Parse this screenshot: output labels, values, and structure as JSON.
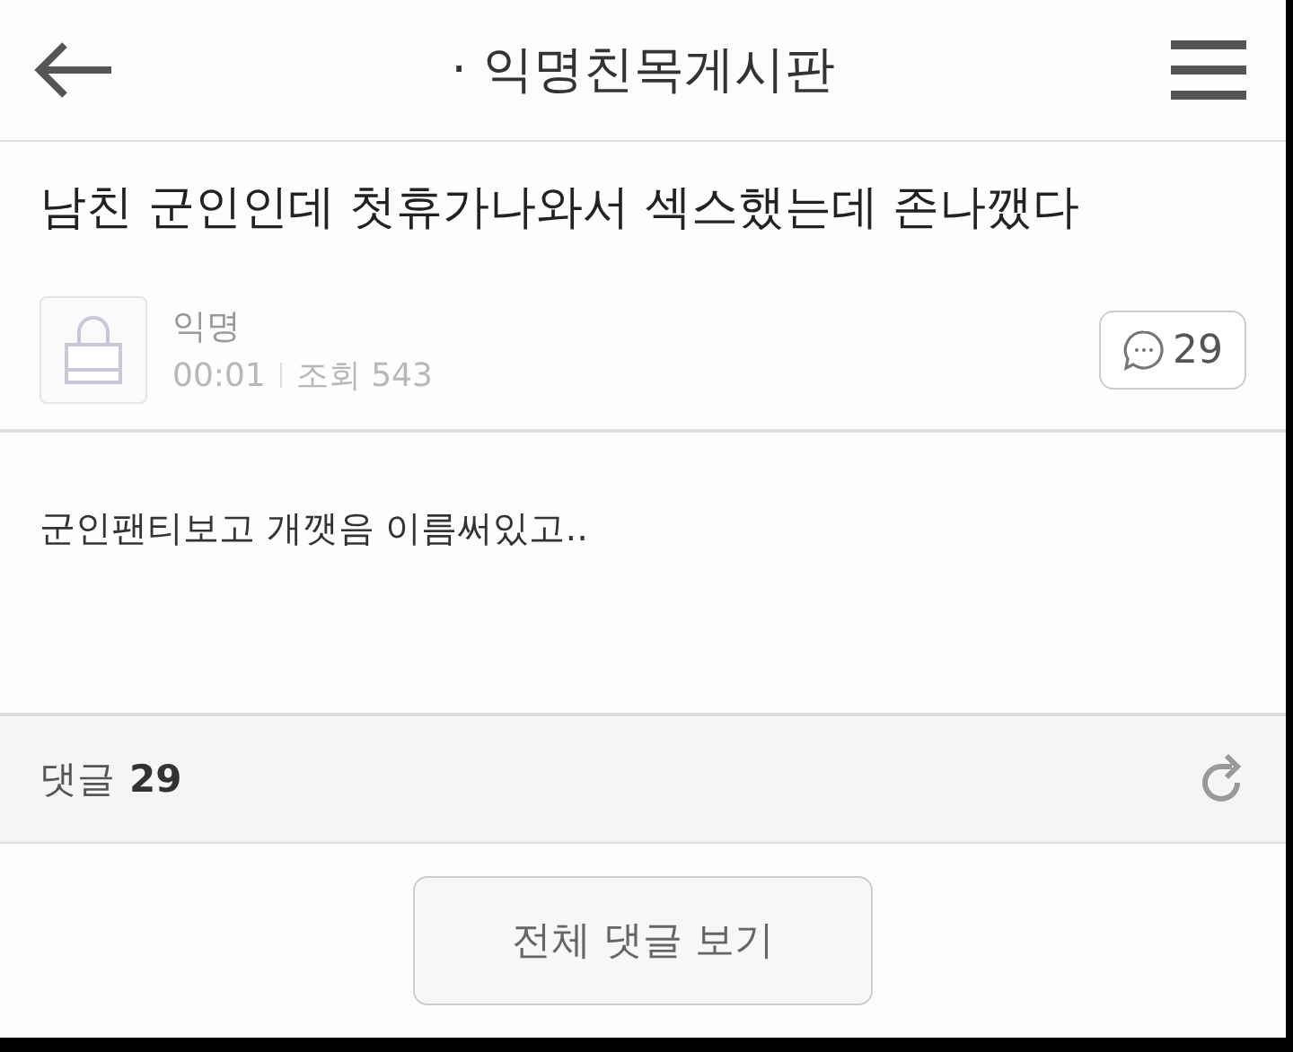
{
  "header": {
    "title": "· 익명친목게시판"
  },
  "post": {
    "title": "남친 군인인데 첫휴가나와서 섹스했는데 존나깼다",
    "author": "익명",
    "time": "00:01",
    "views": "조회 543",
    "comment_count": "29",
    "body": "군인팬티보고 개깻음 이름써있고.."
  },
  "comments": {
    "label": "댓글",
    "count": "29"
  },
  "buttons": [
    "전체 댓글 보기"
  ]
}
